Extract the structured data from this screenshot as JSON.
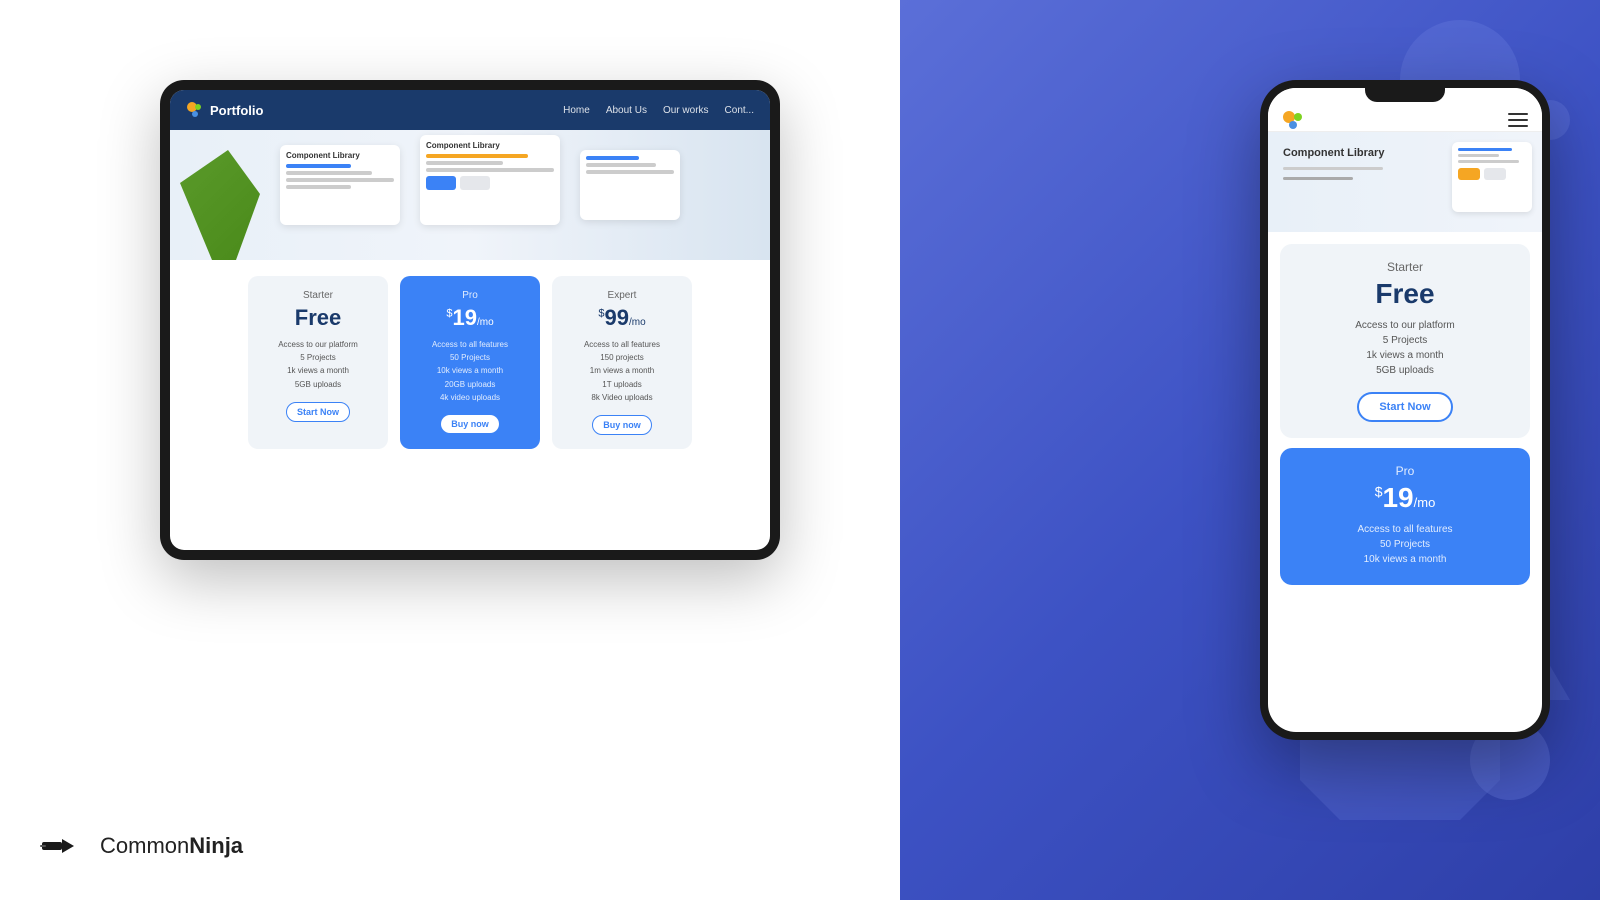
{
  "brand": {
    "name_light": "Common",
    "name_bold": "Ninja",
    "logo_alt": "CommonNinja logo"
  },
  "tablet": {
    "nav": {
      "logo_text": "Portfolio",
      "items": [
        "Home",
        "About Us",
        "Our works",
        "Cont..."
      ]
    },
    "hero": {
      "title": "Component Library"
    },
    "pricing": {
      "plans": [
        {
          "name": "Starter",
          "price_label": "Free",
          "features": [
            "Access to our platform",
            "5 Projects",
            "1k views a month",
            "5GB uploads"
          ],
          "cta": "Start Now",
          "highlighted": false
        },
        {
          "name": "Pro",
          "price_currency": "$",
          "price_amount": "19",
          "price_period": "/mo",
          "features": [
            "Access to all features",
            "50 Projects",
            "10k views a month",
            "20GB uploads",
            "4k video uploads"
          ],
          "cta": "Buy now",
          "highlighted": true
        },
        {
          "name": "Expert",
          "price_currency": "$",
          "price_amount": "99",
          "price_period": "/mo",
          "features": [
            "Access to all features",
            "150 projects",
            "1m views a month",
            "1T uploads",
            "8k Video uploads"
          ],
          "cta": "Buy now",
          "highlighted": false
        }
      ]
    }
  },
  "phone": {
    "pricing": {
      "plans": [
        {
          "name": "Starter",
          "price_label": "Free",
          "features": [
            "Access to our platform",
            "5 Projects",
            "1k views a month",
            "5GB uploads"
          ],
          "cta": "Start Now",
          "type": "starter"
        },
        {
          "name": "Pro",
          "price_currency": "$",
          "price_amount": "19",
          "price_period": "/mo",
          "features": [
            "Access to all features",
            "50 Projects",
            "10k views a month"
          ],
          "type": "pro"
        }
      ]
    }
  }
}
